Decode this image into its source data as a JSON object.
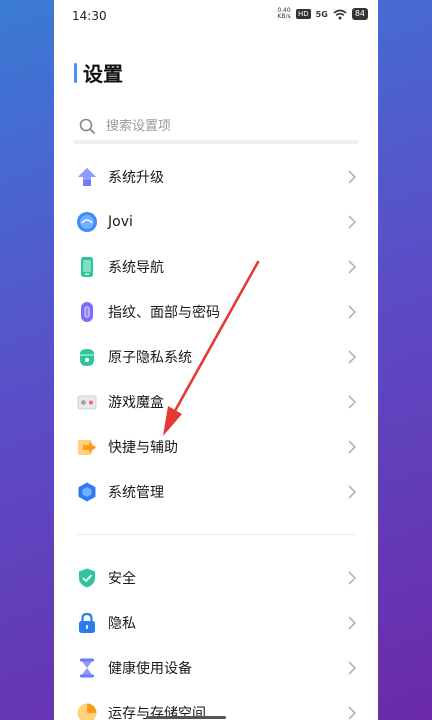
{
  "status_bar": {
    "time": "14:30",
    "net_speed_value": "0.40",
    "net_speed_unit": "KB/s",
    "hd_badge": "HD",
    "network": "5G",
    "battery": "84"
  },
  "page": {
    "title": "设置"
  },
  "search": {
    "placeholder": "搜索设置项"
  },
  "group1": [
    {
      "label": "系统升级",
      "icon": "upgrade-arrow-icon"
    },
    {
      "label": "Jovi",
      "icon": "jovi-icon"
    },
    {
      "label": "系统导航",
      "icon": "phone-navigation-icon"
    },
    {
      "label": "指纹、面部与密码",
      "icon": "fingerprint-icon"
    },
    {
      "label": "原子隐私系统",
      "icon": "privacy-shield-icon"
    },
    {
      "label": "游戏魔盒",
      "icon": "game-box-icon"
    },
    {
      "label": "快捷与辅助",
      "icon": "shortcut-arrow-icon"
    },
    {
      "label": "系统管理",
      "icon": "hexagon-icon"
    }
  ],
  "group2": [
    {
      "label": "安全",
      "icon": "security-shield-icon"
    },
    {
      "label": "隐私",
      "icon": "lock-icon"
    },
    {
      "label": "健康使用设备",
      "icon": "hourglass-icon"
    },
    {
      "label": "运存与存储空间",
      "icon": "storage-pie-icon"
    }
  ],
  "colors": {
    "accent": "#4c8ff5",
    "annotation_arrow": "#e53935"
  }
}
